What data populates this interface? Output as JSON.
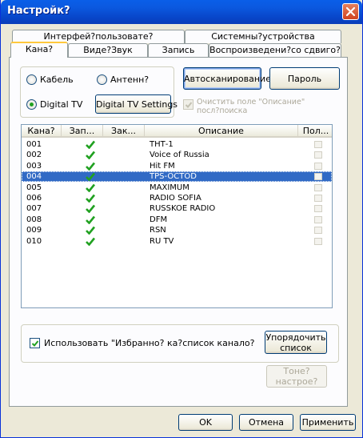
{
  "window": {
    "title": "Настройк?"
  },
  "tabs_back": [
    {
      "label": "Интерфей?пользовате?"
    },
    {
      "label": "Системны?устройства"
    }
  ],
  "tabs_front": [
    {
      "label": "Кана?",
      "active": true
    },
    {
      "label": "Виде?Звук"
    },
    {
      "label": "Запись"
    },
    {
      "label": "Воспроизведени?со сдвиго?"
    }
  ],
  "source": {
    "cable": "Кабель",
    "antenna": "Антенн?",
    "digital": "Digital TV",
    "selected": "Digital TV",
    "digital_settings": "Digital TV Settings"
  },
  "actions": {
    "autoscan": "Автосканирование",
    "password": "Пароль",
    "clear_desc": "Очистить поле \"Описание\" посл?поиска",
    "clear_desc_checked": true
  },
  "list": {
    "columns": [
      "Кана?",
      "Зап...",
      "Зак...",
      "Описание",
      "Пол..."
    ],
    "rows": [
      {
        "channel": "001",
        "recorded": true,
        "description": "ТНТ-1"
      },
      {
        "channel": "002",
        "recorded": true,
        "description": "Voice of Russia"
      },
      {
        "channel": "003",
        "recorded": true,
        "description": "Hit FM"
      },
      {
        "channel": "004",
        "recorded": true,
        "description": "TPS-OCTOD",
        "selected": true
      },
      {
        "channel": "005",
        "recorded": true,
        "description": "MAXIMUM"
      },
      {
        "channel": "006",
        "recorded": true,
        "description": "RADIO SOFIA"
      },
      {
        "channel": "007",
        "recorded": true,
        "description": "RUSSKOE RADIO"
      },
      {
        "channel": "008",
        "recorded": true,
        "description": "DFM"
      },
      {
        "channel": "009",
        "recorded": true,
        "description": "RSN"
      },
      {
        "channel": "010",
        "recorded": true,
        "description": "RU TV"
      }
    ]
  },
  "favorites": {
    "label": "Использовать \"Избранно? ка?список канало?",
    "checked": true,
    "sort_button": "Упорядочить список",
    "settings_button": "Тоне? настрое?"
  },
  "footer": {
    "ok": "OK",
    "cancel": "Отмена",
    "apply": "Применить"
  },
  "colors": {
    "titlebar": "#0a5ee8",
    "selection": "#316ac5",
    "check_green": "#21a121",
    "tab_accent": "#ffc83c"
  }
}
